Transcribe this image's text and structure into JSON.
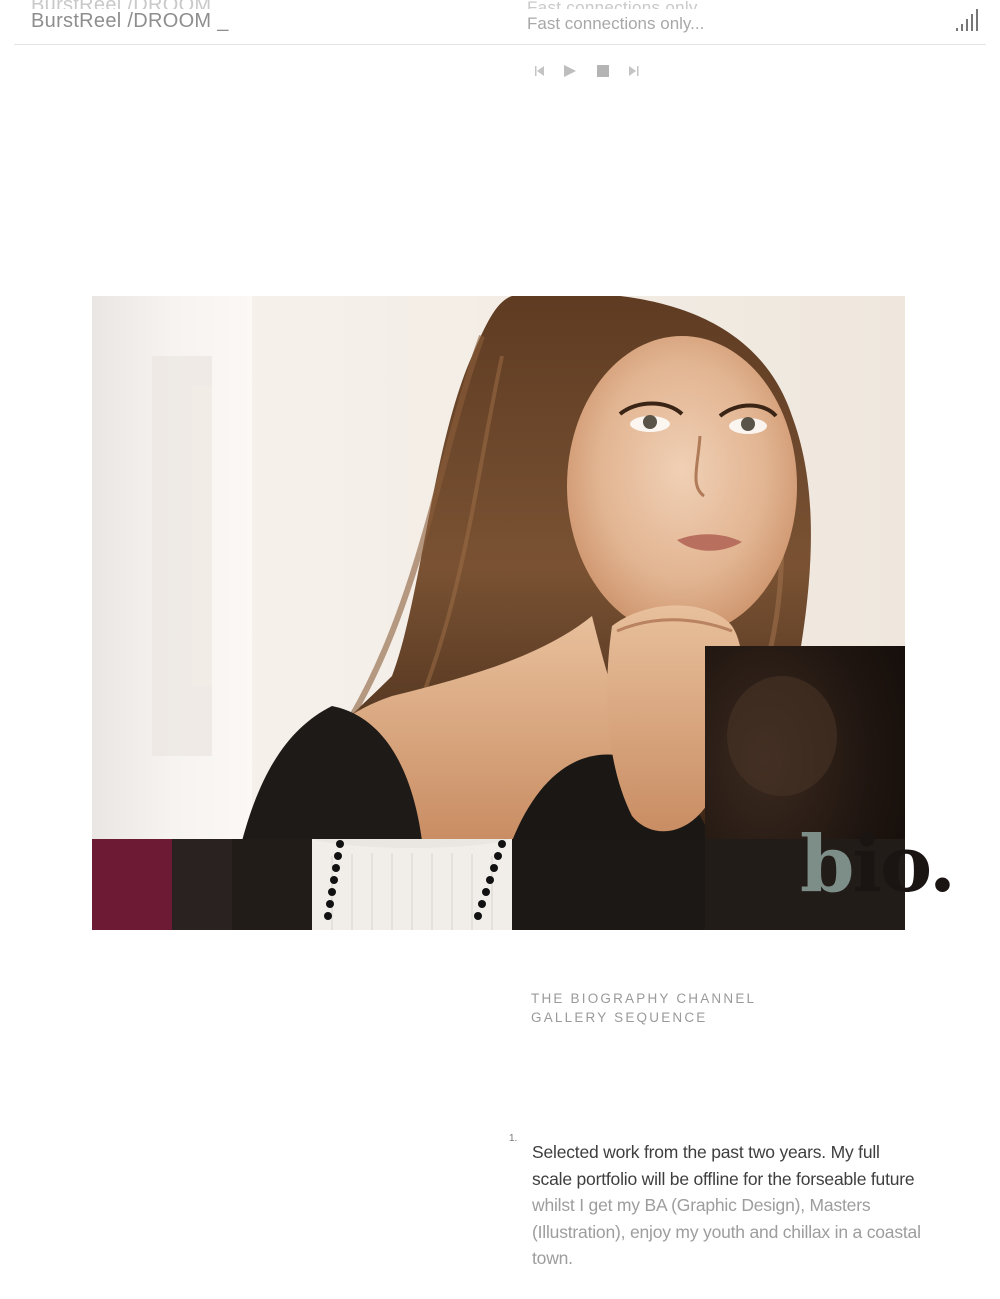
{
  "header": {
    "brand": "BurstReel /DROOM _",
    "brand_ghost": "BurstReel /DROOM",
    "connection_note": "Fast connections only...",
    "connection_ghost": "Fast connections only...",
    "signal_icon": "signal-strength-icon"
  },
  "player": {
    "controls": [
      "skip-back-icon",
      "play-icon",
      "stop-icon",
      "skip-forward-icon"
    ]
  },
  "hero": {
    "title_word": "bio."
  },
  "caption": {
    "line1": "THE BIOGRAPHY CHANNEL",
    "line2": "GALLERY SEQUENCE"
  },
  "intro": {
    "number": "1.",
    "text_dark": "Selected work from the past two years. My full scale portfolio will be offline for the forseable future",
    "text_light": " whilst I get my BA (Graphic Design), Masters (Illustration), enjoy my youth and chillax in a coastal town."
  },
  "colors": {
    "accent_gray": "#7d8e88",
    "text_dark": "#3e3e3e",
    "text_light": "#9d9d9d",
    "magenta_strip": "#7a1c3a"
  }
}
